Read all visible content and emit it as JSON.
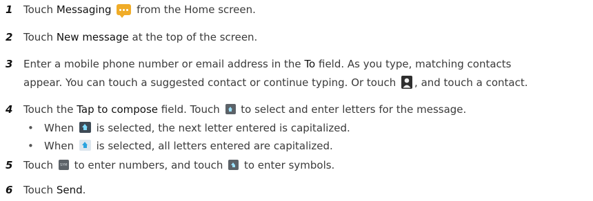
{
  "steps": [
    {
      "num": "1",
      "pre": "Touch ",
      "bold": "Messaging",
      "post": " from the Home screen.",
      "icon": "messaging-app-icon"
    },
    {
      "num": "2",
      "pre": "Touch ",
      "bold": "New message",
      "post": " at the top of the screen."
    },
    {
      "num": "3",
      "pre": "Enter a mobile phone number or email address in the ",
      "bold": "To",
      "post": " field. As you type, matching contacts",
      "line2_pre": "appear. You can touch a suggested contact or continue typing. Or touch ",
      "line2_post": ", and touch a contact.",
      "icon": "contact-icon"
    },
    {
      "num": "4",
      "pre": "Touch the ",
      "bold": "Tap to compose",
      "post": " field. Touch ",
      "post2": " to select and enter letters for the message.",
      "icon": "keyboard-icon",
      "bullets": [
        {
          "pre": "When ",
          "post": " is selected, the next letter entered is capitalized.",
          "icon": "shift-once-icon"
        },
        {
          "pre": "When ",
          "post": " is selected, all letters entered are capitalized.",
          "icon": "shift-lock-icon"
        }
      ]
    },
    {
      "num": "5",
      "pre": "Touch ",
      "mid": " to enter numbers, and touch ",
      "post": " to enter symbols.",
      "icon1_label": "SYM",
      "icons": [
        "sym-key-icon",
        "keyboard-icon"
      ]
    },
    {
      "num": "6",
      "pre": "Touch ",
      "bold": "Send",
      "post": "."
    }
  ],
  "bullet_char": "•"
}
